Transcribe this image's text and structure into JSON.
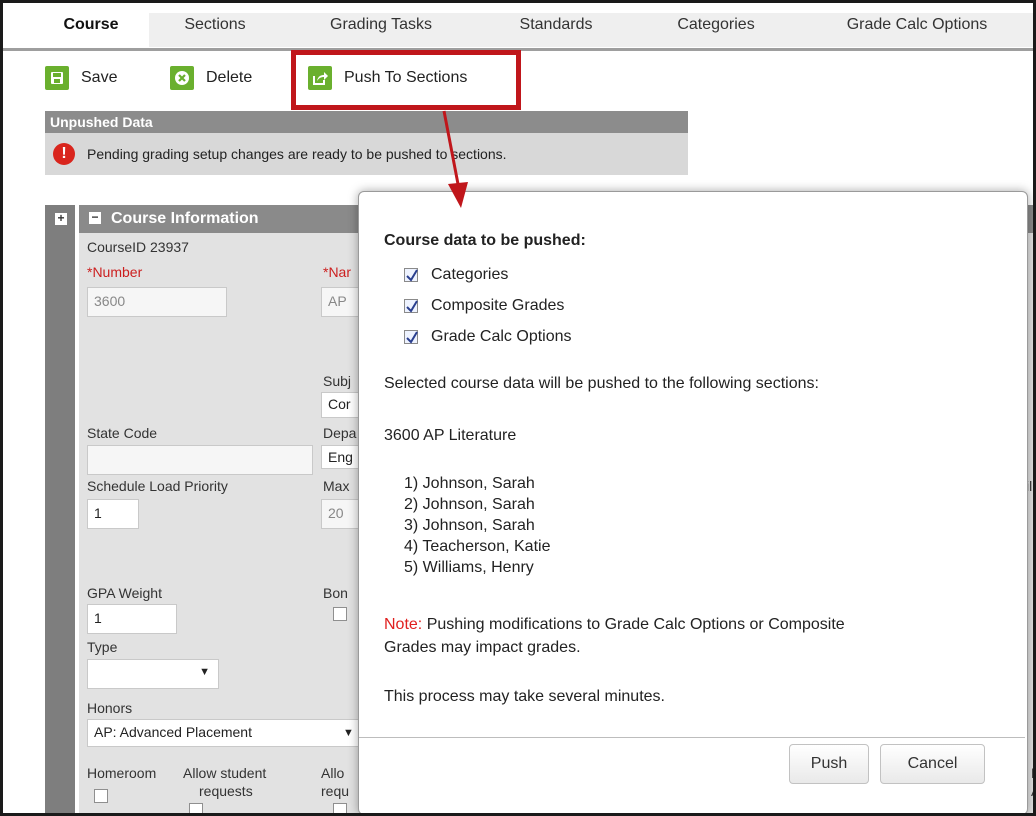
{
  "tabs": [
    {
      "label": "Course",
      "active": true
    },
    {
      "label": "Sections",
      "active": false
    },
    {
      "label": "Grading Tasks",
      "active": false
    },
    {
      "label": "Standards",
      "active": false
    },
    {
      "label": "Categories",
      "active": false
    },
    {
      "label": "Grade Calc Options",
      "active": false
    }
  ],
  "toolbar": {
    "save_label": "Save",
    "delete_label": "Delete",
    "push_label": "Push To Sections"
  },
  "unpushed": {
    "header": "Unpushed Data",
    "message": "Pending grading setup changes are ready to be pushed to sections.",
    "alert_glyph": "!"
  },
  "course_info": {
    "header": "Course Information",
    "course_id": "CourseID 23937",
    "number_label": "*Number",
    "number_value": "3600",
    "name_label": "*Nar",
    "name_value": "AP",
    "subject_label": "Subj",
    "subject_value": "Cor",
    "state_code_label": "State Code",
    "department_label": "Depa",
    "department_value": "Eng",
    "schedule_priority_label": "Schedule Load Priority",
    "schedule_priority_value": "1",
    "max_label": "Max",
    "max_value": "20",
    "gpa_weight_label": "GPA Weight",
    "gpa_weight_value": "1",
    "bonus_label": "Bon",
    "type_label": "Type",
    "honors_label": "Honors",
    "honors_value": "AP: Advanced Placement",
    "homeroom_label": "Homeroom",
    "allow_student_label": "Allow student",
    "allow_student_label2": "requests",
    "allow_label": "Allo",
    "allow_label2": "requ",
    "right_edge_1": "t I",
    "right_edge_2": "il",
    "right_edge_3": "F",
    "right_edge_4": "A"
  },
  "modal": {
    "title": "Course data to be pushed:",
    "options": [
      {
        "label": "Categories",
        "checked": true
      },
      {
        "label": "Composite Grades",
        "checked": true
      },
      {
        "label": "Grade Calc Options",
        "checked": true
      }
    ],
    "selected_text": "Selected course data will be pushed to the following sections:",
    "course_name": "3600 AP Literature",
    "sections": [
      "1) Johnson, Sarah",
      "2) Johnson, Sarah",
      "3) Johnson, Sarah",
      "4) Teacherson, Katie",
      "5) Williams, Henry"
    ],
    "note_prefix": "Note:",
    "note_line1": " Pushing modifications to Grade Calc Options or Composite",
    "note_line2": "Grades may impact grades.",
    "process_text": "This process may take several minutes.",
    "push_button": "Push",
    "cancel_button": "Cancel"
  },
  "colors": {
    "accent_green": "#6ab02e",
    "highlight_red": "#c0161b",
    "header_gray": "#8a8a8a"
  }
}
